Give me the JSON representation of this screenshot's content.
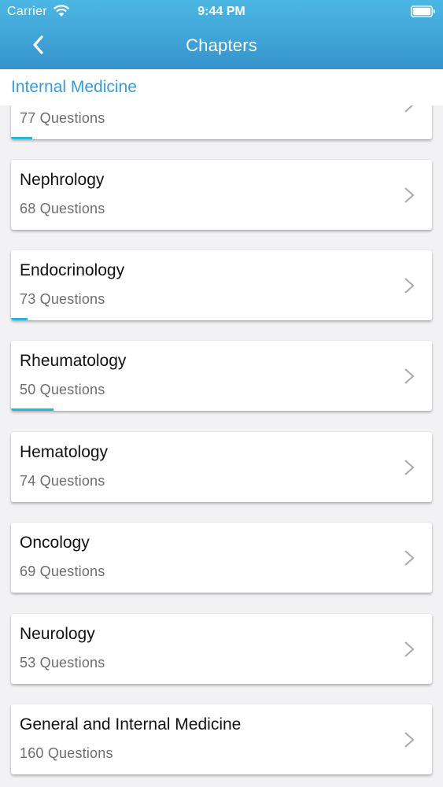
{
  "status_bar": {
    "carrier": "Carrier",
    "time": "9:44 PM"
  },
  "nav": {
    "title": "Chapters",
    "back_icon": "chevron-left-icon"
  },
  "section": {
    "title": "Internal Medicine"
  },
  "colors": {
    "header": "#3fa2d6",
    "accent": "#3b9ad6",
    "progress": "#29b4d8"
  },
  "chapters": [
    {
      "name": "",
      "questions": "77 Questions",
      "progress": 0.05
    },
    {
      "name": "Nephrology",
      "questions": "68 Questions",
      "progress": 0
    },
    {
      "name": "Endocrinology",
      "questions": "73 Questions",
      "progress": 0.04
    },
    {
      "name": "Rheumatology",
      "questions": "50 Questions",
      "progress": 0.1
    },
    {
      "name": "Hematology",
      "questions": "74 Questions",
      "progress": 0
    },
    {
      "name": "Oncology",
      "questions": "69 Questions",
      "progress": 0
    },
    {
      "name": "Neurology",
      "questions": "53 Questions",
      "progress": 0
    },
    {
      "name": "General and Internal Medicine",
      "questions": "160 Questions",
      "progress": 0
    }
  ]
}
